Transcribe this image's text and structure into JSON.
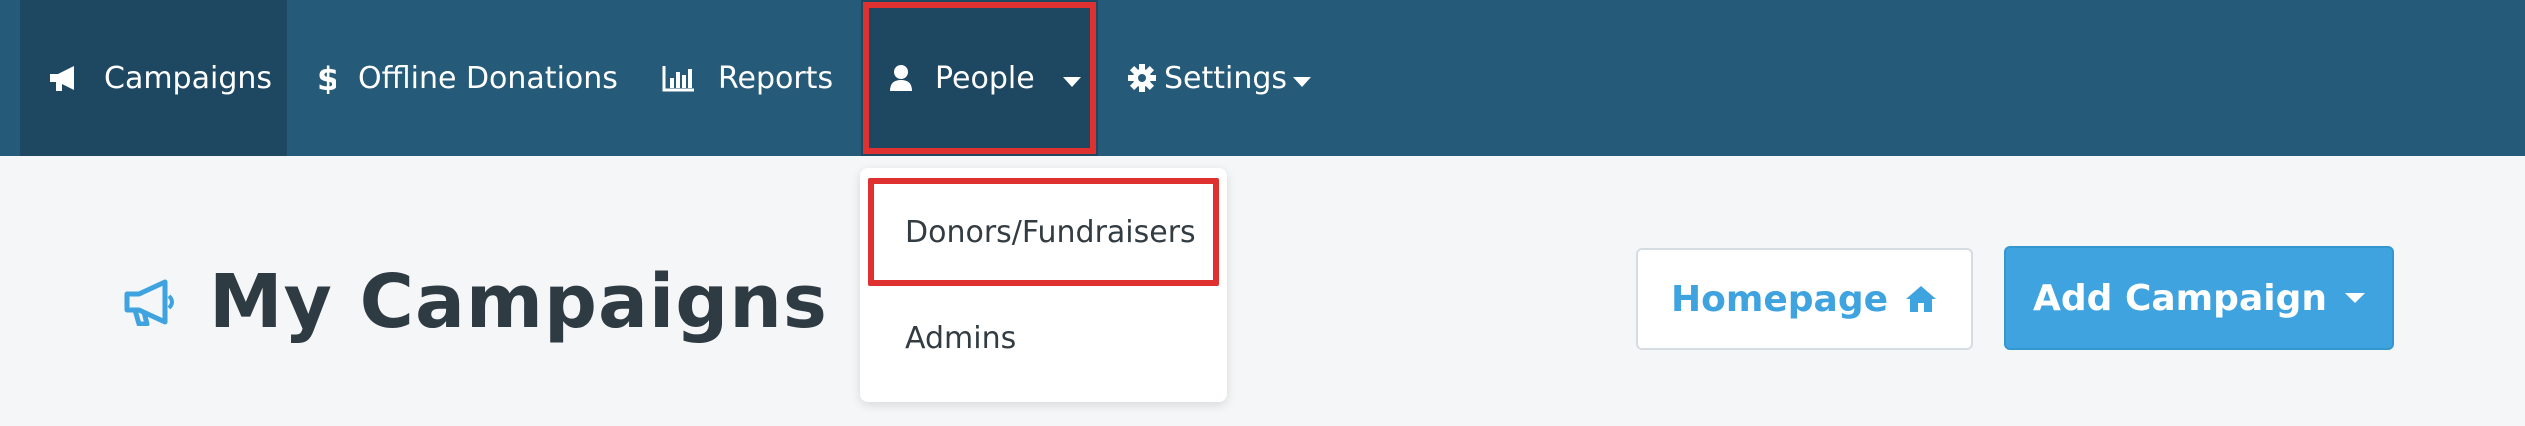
{
  "nav": {
    "items": [
      {
        "label": "Campaigns",
        "icon": "megaphone-icon"
      },
      {
        "label": "Offline Donations",
        "icon": "dollar-icon"
      },
      {
        "label": "Reports",
        "icon": "bar-chart-icon"
      },
      {
        "label": "People",
        "icon": "user-icon"
      },
      {
        "label": "Settings",
        "icon": "gear-icon"
      }
    ]
  },
  "people_menu": {
    "items": [
      {
        "label": "Donors/Fundraisers"
      },
      {
        "label": "Admins"
      }
    ]
  },
  "page": {
    "title": "My Campaigns"
  },
  "actions": {
    "homepage_label": "Homepage",
    "add_campaign_label": "Add Campaign"
  },
  "colors": {
    "nav_bg": "#255a78",
    "nav_active_bg": "#1e4862",
    "highlight": "#e03131",
    "accent": "#3ea3df"
  }
}
